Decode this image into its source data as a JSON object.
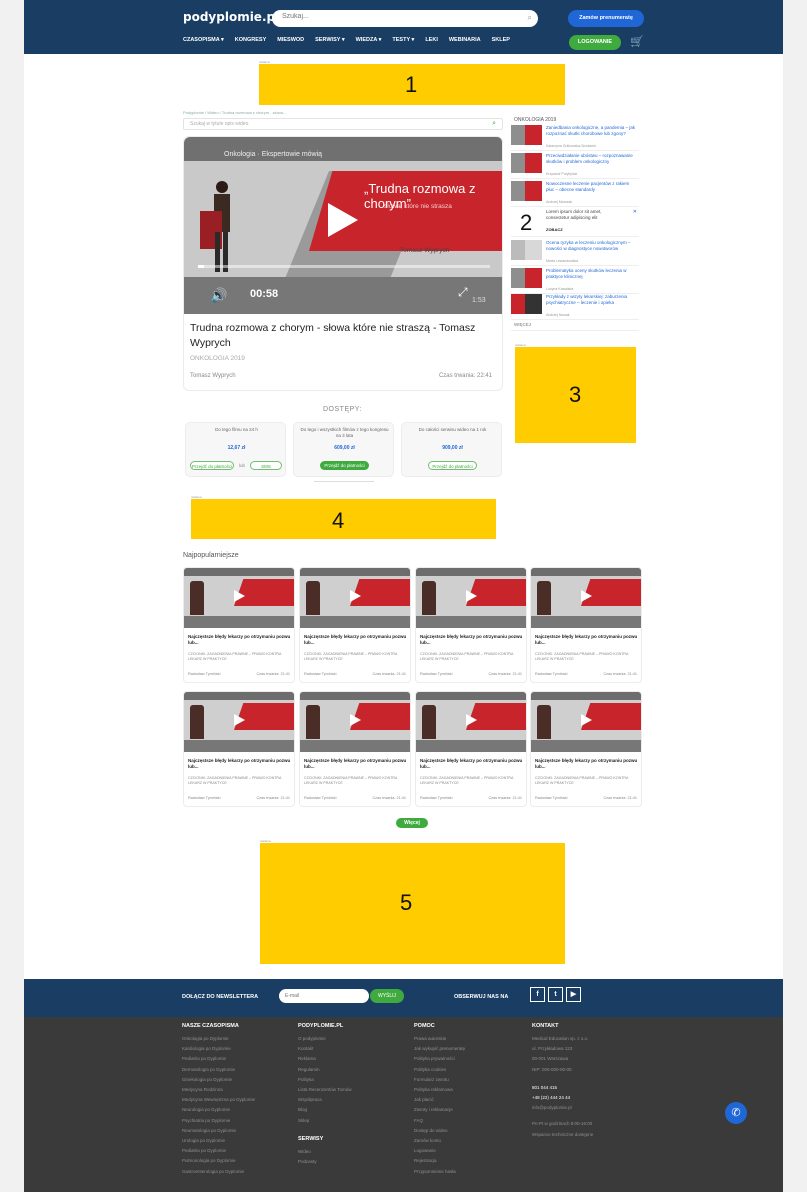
{
  "header": {
    "logo": "podyplomie.pl",
    "search_placeholder": "Szukaj...",
    "subscribe": "Zamów prenumeratę",
    "nav": [
      "CZASOPISMA ▾",
      "KONGRESY",
      "MIESWOD",
      "SERWISY ▾",
      "WIEDZA ▾",
      "TESTY ▾",
      "LEKI",
      "WEBINARIA",
      "SKLEP"
    ],
    "login": "LOGOWANIE"
  },
  "ads": [
    "1",
    "2",
    "3",
    "4",
    "5"
  ],
  "ad_tag": "reklama",
  "breadcrumb": "Podyplomie / Wideo / Trudna rozmowa z chorym - słowa...",
  "filter_placeholder": "Szukaj w tytule opis wideo",
  "video": {
    "top_line": "Onkologia · Ekspertowie mówią",
    "overlay_title": "„Trudna rozmowa z chorym”",
    "overlay_subtitle": "słowa, które nie strasza",
    "overlay_author": "Tomasz Wyprych",
    "time": "00:58",
    "watermark": "1:53",
    "title": "Trudna rozmowa z chorym - słowa które nie straszą - Tomasz Wyprych",
    "category": "ONKOLOGIA 2019",
    "author": "Tomasz Wyprych",
    "duration": "Czas trwania: 22:41"
  },
  "access": {
    "title": "DOSTĘPY:",
    "options": [
      {
        "desc": "Do tego filmu na 24 h",
        "price": "12,67 zł",
        "btn1": "Przejdź do płatności",
        "or": "lub",
        "btn2": "SMS"
      },
      {
        "desc": "Do tego i wszystkich filmów z tego kongresu na 3 lata",
        "price": "609,00 zł",
        "btn1": "Przejdź do płatności"
      },
      {
        "desc": "Do całości serwisu wideo na 1 rok",
        "price": "909,00 zł",
        "btn1": "Przejdź do płatności"
      }
    ]
  },
  "sidebar": {
    "header": "ONKOLOGIA 2019",
    "items": [
      {
        "title": "Zaniedbania onkologiczne, a pandemia – jak rozpoznać skutki chorobowe lub zgony?",
        "author": "Katarzyna Gutkowska-Smolarek"
      },
      {
        "title": "Przeciwdziałanie ubóstwu – rozpoznawanie skutków i problem onkologiczny",
        "author": "Krzysztof Przybylski"
      },
      {
        "title": "Nowoczesne leczenie pacjentów z rakiem płuc – obecne standardy",
        "author": "Andrzej Marczak"
      }
    ],
    "ad": {
      "text": "Lorem ipsum dolor sit amet, consectetur adipiscing elit",
      "cta": "ZOBACZ",
      "close": "✕"
    },
    "items2": [
      {
        "title": "Ocena ryzyka w leczeniu onkologicznym – nowości w diagnostyce nowotworów",
        "author": "Marta Lewandowska"
      },
      {
        "title": "Problematyka oceny skutków leczenia w praktyce klinicznej",
        "author": "Lucyna Kowalska"
      },
      {
        "title": "Przykłady z wizyty lekarskiej: zaburzenia psychiatryczne – leczenie i opieka",
        "author": "Andrzej Nowak"
      }
    ],
    "footer": "WIĘCEJ"
  },
  "popular": {
    "heading": "Najpopularniejsze",
    "card": {
      "title": "Najczęstsze błędy lekarzy po otrzymaniu pozwu lub...",
      "category": "CZCIONKI: ZAGADNIENIA PRAWNE – PRAWO KONTRA LEKARZ W PRAKTYCE",
      "author": "Radosław Tymiński",
      "duration": "Czas trwania: 21:41"
    },
    "more": "Więcej"
  },
  "newsletter": {
    "label": "DOŁĄCZ DO NEWSLETTERA",
    "placeholder": "E-mail",
    "submit": "WYŚLIJ",
    "follow": "OBSERWUJ NAS NA",
    "social": [
      "f",
      "t",
      "▶"
    ]
  },
  "footer": {
    "col1": {
      "title": "NASZE CZASOPISMA",
      "items": [
        "Onkologia po Dyplomie",
        "Kardiologia po Dyplomie",
        "Pediatria po Dyplomie",
        "Dermatologia po Dyplomie",
        "Ginekologia po Dyplomie",
        "Medycyna Rodzinna",
        "Medycyna Wewnętrzna po Dyplomie",
        "Neurologia po Dyplomie",
        "Psychiatria po Dyplomie",
        "Reumatologia po Dyplomie",
        "Urologia po Dyplomie",
        "Pediatria po Dyplomie",
        "Pulmonologia po Dyplomie",
        "Gastroenterologia po Dyplomie"
      ]
    },
    "col2": {
      "title": "PODYPLOMIE.PL",
      "items": [
        "O podyplomie",
        "Kontakt",
        "Reklama",
        "Regulamin",
        "Polityka",
        "Lista Recenzentów Tomów",
        "Współpraca",
        "Blog",
        "Sklep"
      ],
      "title2": "SERWISY",
      "items2": [
        "Wideo",
        "Podcasty"
      ]
    },
    "col3": {
      "title": "POMOC",
      "items": [
        "Prawa autorskie",
        "Jak wykupić prenumeratę",
        "Polityka prywatności",
        "Polityka cookies",
        "Formularz zwrotu",
        "Polityka reklamowa",
        "Jak płacić",
        "Zwroty i reklamacje",
        "FAQ",
        "Dostęp do wideo",
        "Zamów konto",
        "Logowanie",
        "Rejestracja",
        "Przypomnienie hasła"
      ]
    },
    "col4": {
      "title": "KONTAKT",
      "items": [
        "Medical Education sp. z o.o.",
        "ul. Przykładowa 123",
        "00-001 Warszawa",
        "NIP: 000-000-00-00"
      ],
      "phone_label": "801 044 415",
      "phone": "+48 (22) 444 24 44",
      "email": "info@podyplomie.pl",
      "hours": [
        "Pn-Pt w godzinach 8:00-16:00",
        "Wsparcie techniczne dostępne"
      ]
    }
  },
  "colors": {
    "navy": "#1a3d63",
    "green": "#3fab3f",
    "blue": "#1f67d6",
    "ad": "#ffcc00",
    "red": "#c8242b"
  }
}
